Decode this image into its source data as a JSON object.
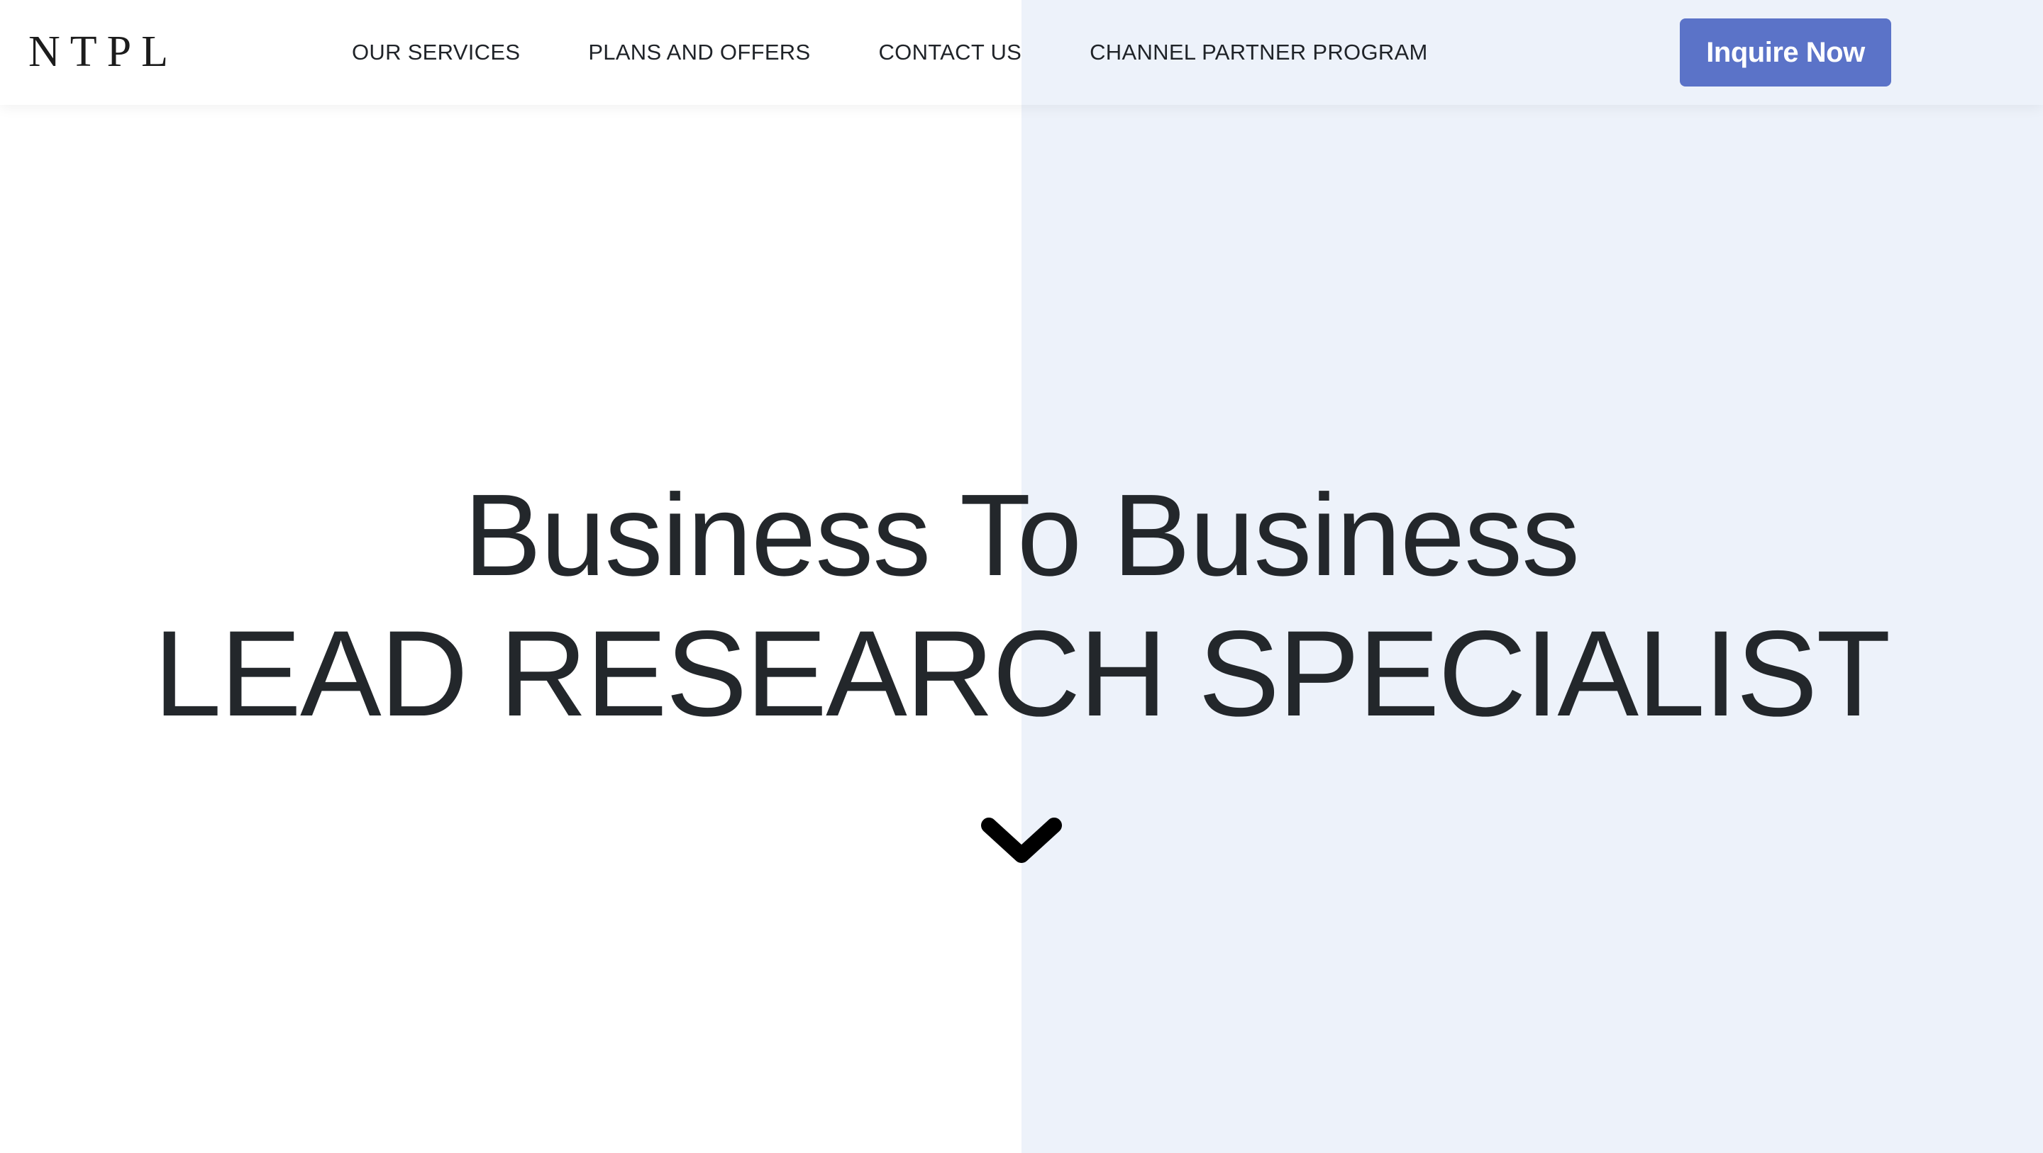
{
  "header": {
    "logo": "NTPL",
    "nav": [
      {
        "label": "OUR SERVICES"
      },
      {
        "label": "PLANS AND OFFERS"
      },
      {
        "label": "CONTACT US"
      },
      {
        "label": "CHANNEL PARTNER PROGRAM"
      }
    ],
    "cta_label": "Inquire Now"
  },
  "hero": {
    "line1": "Business To Business",
    "line2": "LEAD RESEARCH SPECIALIST",
    "scroll_icon": "chevron-down-icon"
  },
  "colors": {
    "accent": "#5b73c8",
    "right_panel": "#edf2fa",
    "text": "#212529"
  }
}
